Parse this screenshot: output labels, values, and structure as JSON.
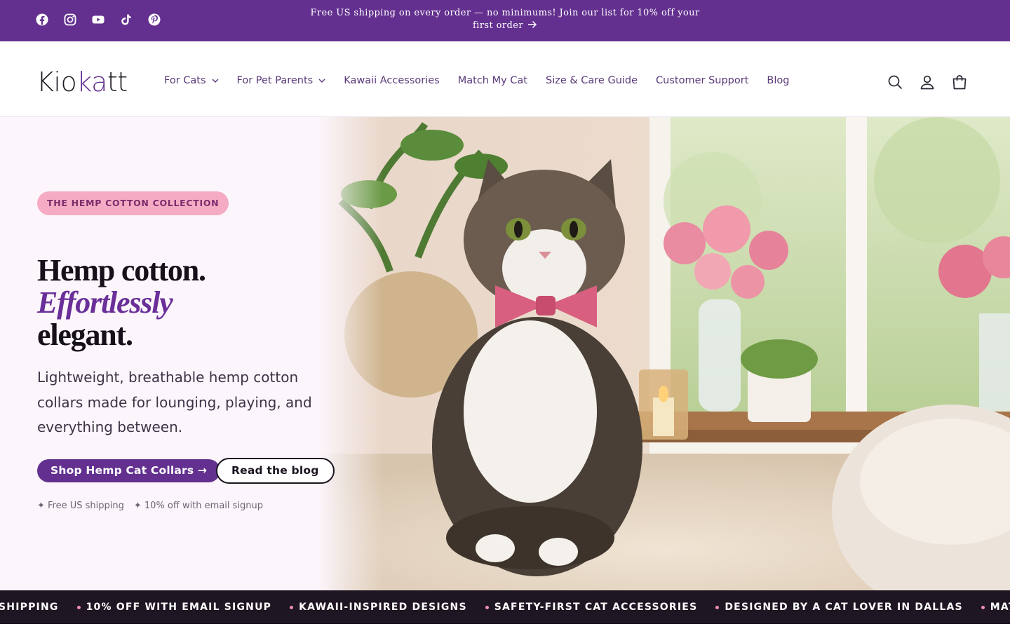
{
  "announcement": {
    "text": "Free US shipping on every order — no minimums! Join our list for 10% off your first order",
    "social_icons": [
      "facebook-icon",
      "instagram-icon",
      "youtube-icon",
      "tiktok-icon",
      "pinterest-icon"
    ]
  },
  "header": {
    "logo": "Kiokatt",
    "nav": [
      {
        "label": "For Cats",
        "has_dropdown": true
      },
      {
        "label": "For Pet Parents",
        "has_dropdown": true
      },
      {
        "label": "Kawaii Accessories",
        "has_dropdown": false
      },
      {
        "label": "Match My Cat",
        "has_dropdown": false
      },
      {
        "label": "Size & Care Guide",
        "has_dropdown": false
      },
      {
        "label": "Customer Support",
        "has_dropdown": false
      },
      {
        "label": "Blog",
        "has_dropdown": false
      }
    ],
    "icons": [
      "search-icon",
      "account-icon",
      "cart-icon"
    ]
  },
  "hero": {
    "badge": "THE HEMP COTTON COLLECTION",
    "headline_line1": "Hemp cotton.",
    "headline_line2": "Effortlessly",
    "headline_line3": "elegant.",
    "lead": "Lightweight, breathable hemp cotton collars made for lounging, playing, and everything between.",
    "primary_cta": "Shop Hemp Cat Collars →",
    "secondary_cta": "Read the blog",
    "perks": [
      "✦ Free US shipping",
      "✦ 10% off with email signup"
    ]
  },
  "marquee": {
    "items": [
      "SHIPPING",
      "10% OFF WITH EMAIL SIGNUP",
      "KAWAII-INSPIRED DESIGNS",
      "SAFETY-FIRST CAT ACCESSORIES",
      "DESIGNED BY A CAT LOVER IN DALLAS",
      "MATCHING SETS FOR"
    ]
  },
  "colors": {
    "brand_purple": "#63308f",
    "accent_pink": "#f4abc3",
    "marquee_bg": "#1e1622",
    "hero_bg": "#fcf6fc"
  }
}
